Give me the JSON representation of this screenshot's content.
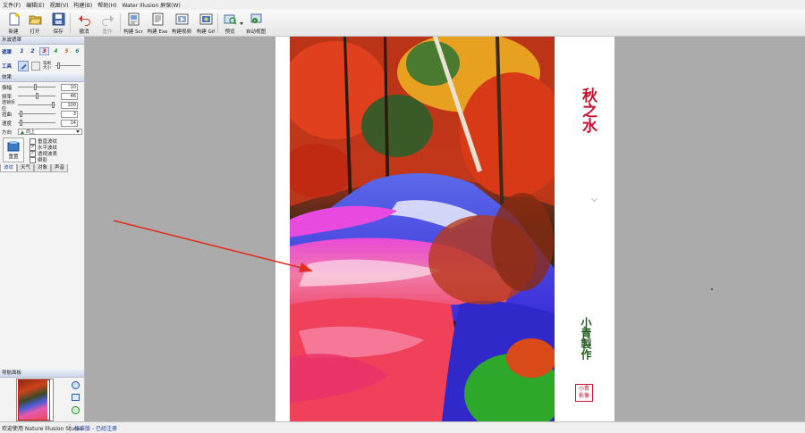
{
  "menu": [
    "文件(F)",
    "编辑(E)",
    "视图(V)",
    "构建(B)",
    "帮助(H)",
    "Water Illusion 屏保(W)"
  ],
  "toolbar": {
    "new": "新建",
    "open": "打开",
    "save": "保存",
    "undo": "撤消",
    "redo": "重作",
    "build_scr": "构建 Scr",
    "build_exe": "构建 Exe",
    "build_video": "构建视频",
    "build_gif": "构建 Gif",
    "preview": "预览",
    "auto_view": "自动视图"
  },
  "left_panel": {
    "water_mask_title": "水波遮罩",
    "mask_label": "遮罩",
    "mask_numbers": [
      "1",
      "2",
      "3",
      "4",
      "5",
      "6"
    ],
    "tools_label": "工具",
    "brush_size_label": "笔刷\n大小",
    "effects_title": "效果",
    "params": [
      {
        "label": "振幅",
        "value": "10"
      },
      {
        "label": "频率",
        "value": "46"
      },
      {
        "label": "连锁反应",
        "value": "100"
      },
      {
        "label": "扭曲",
        "value": "3"
      },
      {
        "label": "速度",
        "value": "14"
      }
    ],
    "direction_label": "方向",
    "direction_value": "向上",
    "checkboxes": [
      {
        "label": "垂直波纹",
        "checked": false
      },
      {
        "label": "水平波纹",
        "checked": true
      },
      {
        "label": "透视波表",
        "checked": true
      },
      {
        "label": "倒影",
        "checked": false
      }
    ],
    "reset_button": "重置",
    "tabs": [
      "波纹",
      "天气",
      "对象",
      "声音"
    ],
    "nav_panel_title": "导航面板"
  },
  "poem": {
    "title": "秋之水",
    "credit": "小青製作",
    "seal": "小青影像"
  },
  "status": {
    "welcome": "欢迎使用 Nature Illusion Studio",
    "edition": "标准版 - 已经注册"
  },
  "colors": {
    "title_red": "#c8102e",
    "credit_green": "#1f5a1a",
    "arrow_red": "#e03020"
  }
}
